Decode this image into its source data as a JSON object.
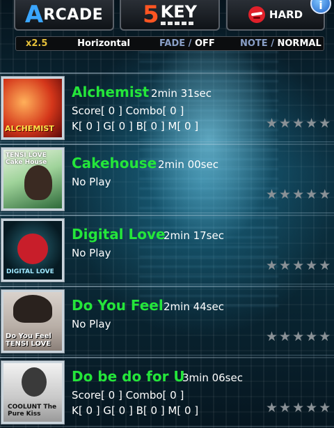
{
  "header": {
    "mode_first_letter": "A",
    "mode_rest": "RCADE",
    "key_number": "5",
    "key_label": "KEY",
    "difficulty_label": "HARD",
    "info_label": "i"
  },
  "options": {
    "speed": "x2.5",
    "scroll": "Horizontal",
    "fade_key": "FADE",
    "fade_sep": "/",
    "fade_value": "OFF",
    "note_key": "NOTE",
    "note_sep": "/",
    "note_value": "NORMAL"
  },
  "songs": [
    {
      "title": "Alchemist",
      "duration": "2min 31sec",
      "line2": "Score[ 0 ]   Combo[ 0 ]",
      "line3": "K[ 0 ] G[ 0 ] B[ 0 ] M[ 0 ]",
      "cover_text": "ALCHEMIST",
      "stars_filled": 0,
      "stars_total": 5
    },
    {
      "title": "Cakehouse",
      "duration": "2min 00sec",
      "line2": "No Play",
      "line3": "",
      "cover_text": "TENSI LOVE Cake House",
      "stars_filled": 0,
      "stars_total": 5
    },
    {
      "title": "Digital Love",
      "duration": "2min 17sec",
      "line2": "No Play",
      "line3": "",
      "cover_text": "DIGITAL LOVE",
      "stars_filled": 0,
      "stars_total": 5
    },
    {
      "title": "Do You Feel",
      "duration": "2min 44sec",
      "line2": "No Play",
      "line3": "",
      "cover_text": "Do You Feel TENSI LOVE",
      "stars_filled": 0,
      "stars_total": 5
    },
    {
      "title": "Do be do for U",
      "duration": "3min 06sec",
      "line2": "Score[ 0 ]   Combo[ 0 ]",
      "line3": "K[ 0 ] G[ 0 ] B[ 0 ] M[ 0 ]",
      "cover_text": "COOLUNT The Pure Kiss",
      "stars_filled": 0,
      "stars_total": 5
    }
  ],
  "colors": {
    "title_green": "#24e63a",
    "speed_gold": "#e8c23a",
    "arcade_blue": "#3aa6ff",
    "key_orange": "#ff5522",
    "hard_red": "#e0202a",
    "star_gray": "#8a9196"
  },
  "icons": {
    "info": "info-icon",
    "difficulty": "angry-face-icon",
    "rating": "star-icon"
  }
}
